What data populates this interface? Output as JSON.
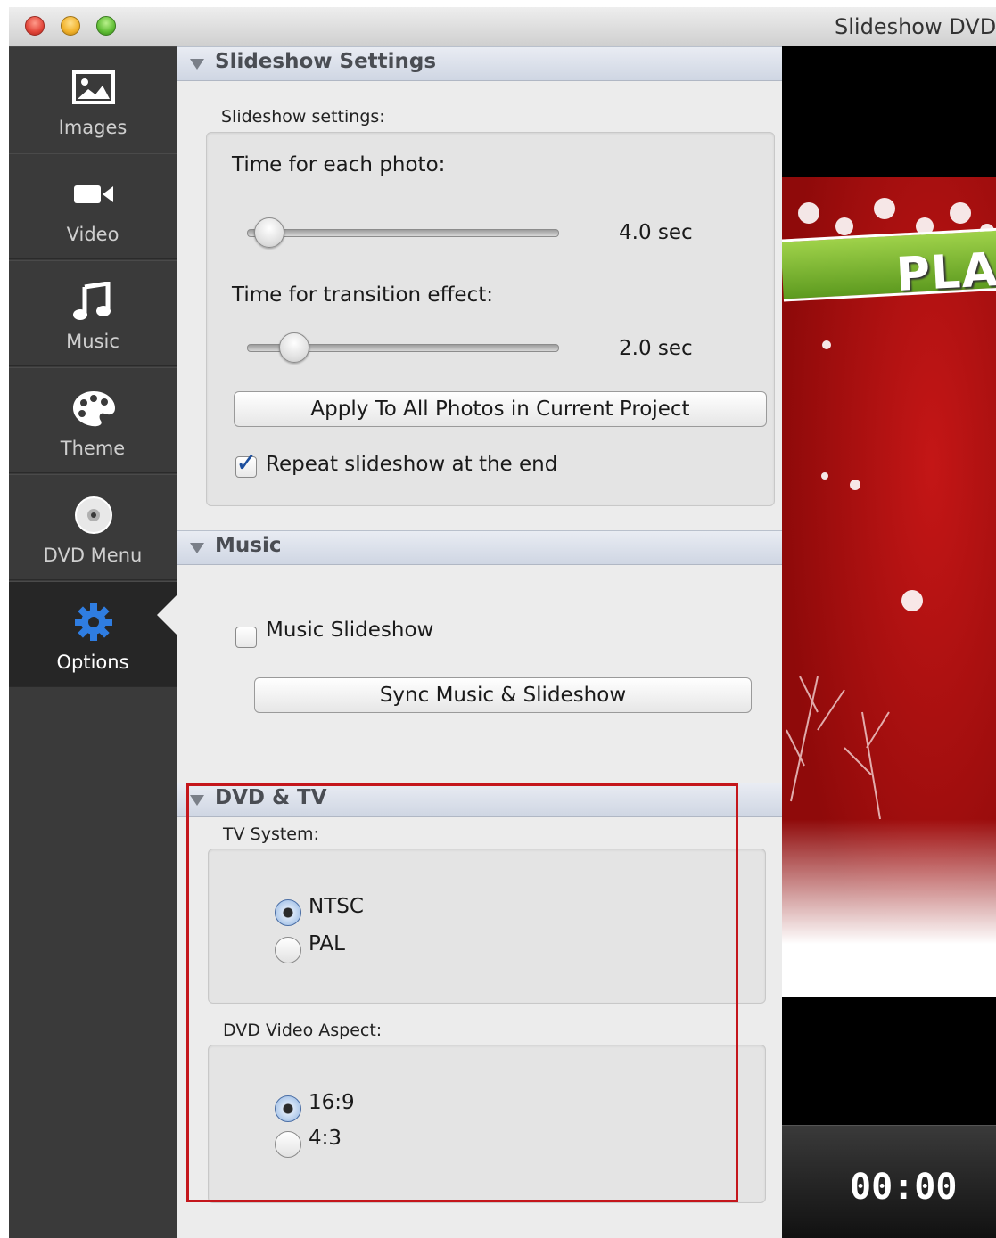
{
  "window": {
    "title": "Slideshow DVD"
  },
  "sidebar": {
    "items": [
      {
        "label": "Images",
        "icon": "image-icon"
      },
      {
        "label": "Video",
        "icon": "video-camera-icon"
      },
      {
        "label": "Music",
        "icon": "music-note-icon"
      },
      {
        "label": "Theme",
        "icon": "palette-icon"
      },
      {
        "label": "DVD Menu",
        "icon": "disc-icon"
      },
      {
        "label": "Options",
        "icon": "gear-icon",
        "active": true
      }
    ]
  },
  "slideshow_section": {
    "header": "Slideshow Settings",
    "group_label": "Slideshow settings:",
    "photo_time_label": "Time for each photo:",
    "photo_time_value": "4.0 sec",
    "photo_slider_fraction": 0.07,
    "transition_label": "Time for transition effect:",
    "transition_value": "2.0 sec",
    "transition_slider_fraction": 0.15,
    "apply_button": "Apply To All Photos in Current Project",
    "repeat_label": "Repeat slideshow at the end",
    "repeat_checked": true
  },
  "music_section": {
    "header": "Music",
    "music_slideshow_label": "Music Slideshow",
    "music_slideshow_checked": false,
    "sync_button": "Sync Music & Slideshow"
  },
  "dvd_section": {
    "header": "DVD & TV",
    "tv_system_label": "TV System:",
    "tv_options": [
      "NTSC",
      "PAL"
    ],
    "tv_selected": "NTSC",
    "aspect_label": "DVD Video Aspect:",
    "aspect_options": [
      "16:9",
      "4:3"
    ],
    "aspect_selected": "16:9"
  },
  "preview": {
    "banner_text": "PLA",
    "timer": "00:00"
  },
  "colors": {
    "sidebar_bg": "#3a3a3a",
    "active_icon": "#2f7de1",
    "highlight_box": "#c4161c"
  }
}
